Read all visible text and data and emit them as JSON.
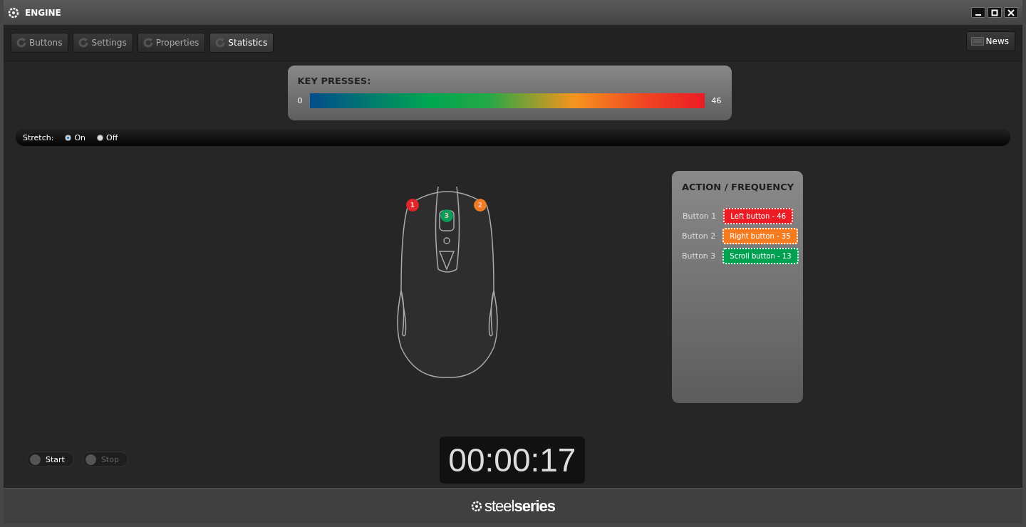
{
  "window": {
    "title": "ENGINE"
  },
  "tabs": [
    {
      "label": "Buttons",
      "selected": false
    },
    {
      "label": "Settings",
      "selected": false
    },
    {
      "label": "Properties",
      "selected": false
    },
    {
      "label": "Statistics",
      "selected": true
    }
  ],
  "news_button": {
    "label": "News"
  },
  "key_presses": {
    "title": "KEY PRESSES:",
    "min": "0",
    "max": "46"
  },
  "stretch": {
    "label": "Stretch:",
    "options": [
      {
        "label": "On",
        "selected": true
      },
      {
        "label": "Off",
        "selected": false
      }
    ]
  },
  "mouse_markers": [
    {
      "label": "1",
      "color": "#e0262b"
    },
    {
      "label": "2",
      "color": "#f07c22"
    },
    {
      "label": "3",
      "color": "#0a9e5a"
    }
  ],
  "action_frequency": {
    "title": "ACTION / FREQUENCY",
    "rows": [
      {
        "label": "Button 1",
        "action": "Left button - 46",
        "color": "#ec1c24"
      },
      {
        "label": "Button 2",
        "action": "Right button - 35",
        "color": "#f47b20"
      },
      {
        "label": "Button 3",
        "action": "Scroll button - 13",
        "color": "#00a151"
      }
    ]
  },
  "controls": [
    {
      "label": "Start",
      "disabled": false
    },
    {
      "label": "Stop",
      "disabled": true
    }
  ],
  "timer": "00:00:17",
  "footer": {
    "logo": "steel**series**"
  }
}
